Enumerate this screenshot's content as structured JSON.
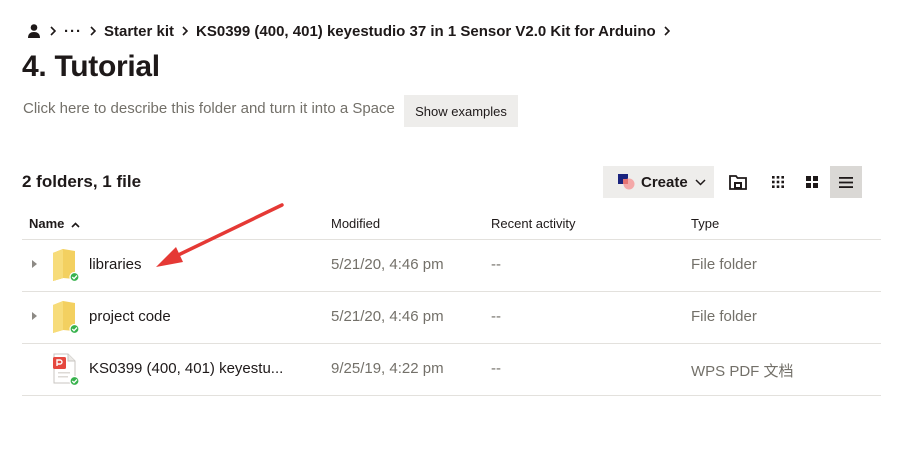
{
  "breadcrumb": {
    "user_icon": "person-icon",
    "overflow_label": "···",
    "items": [
      "Starter kit",
      "KS0399 (400, 401) keyestudio 37 in 1 Sensor V2.0 Kit for Arduino"
    ]
  },
  "page": {
    "title": "4. Tutorial",
    "describe_text": "Click here to describe this folder and turn it into a Space",
    "show_examples_label": "Show examples",
    "count_text": "2 folders, 1 file"
  },
  "toolbar": {
    "create_label": "Create",
    "icons": [
      "folder-upload-icon",
      "small-grid-view-icon",
      "large-grid-view-icon",
      "list-view-icon"
    ],
    "active_view": "list-view-icon"
  },
  "table": {
    "headers": {
      "name": "Name",
      "modified": "Modified",
      "activity": "Recent activity",
      "type": "Type"
    },
    "sort": "name-ascending",
    "rows": [
      {
        "name": "libraries",
        "modified": "5/21/20, 4:46 pm",
        "activity": "--",
        "type": "File folder",
        "icon": "folder-icon",
        "synced": true,
        "expandable": true
      },
      {
        "name": "project code",
        "modified": "5/21/20, 4:46 pm",
        "activity": "--",
        "type": "File folder",
        "icon": "folder-icon",
        "synced": true,
        "expandable": true
      },
      {
        "name": "KS0399 (400, 401) keyestu...",
        "modified": "9/25/19, 4:22 pm",
        "activity": "--",
        "type": "WPS PDF 文档",
        "icon": "pdf-file-icon",
        "synced": true,
        "expandable": false
      }
    ]
  },
  "colors": {
    "accent_arrow": "#e53935",
    "sync_green": "#37b24d",
    "folder_yellow": "#f3d060",
    "button_bg": "#eeedeb",
    "active_view_bg": "#dad8d5"
  }
}
